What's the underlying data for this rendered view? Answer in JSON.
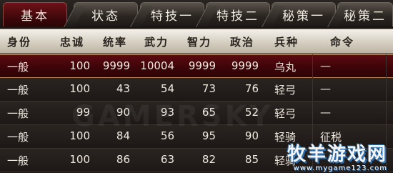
{
  "tabs": [
    {
      "label": "基本",
      "active": true
    },
    {
      "label": "状态",
      "active": false
    },
    {
      "label": "特技一",
      "active": false
    },
    {
      "label": "特技二",
      "active": false
    },
    {
      "label": "秘策一",
      "active": false
    },
    {
      "label": "秘策二",
      "active": false
    }
  ],
  "headers": [
    "身份",
    "忠诚",
    "统率",
    "武力",
    "智力",
    "政治",
    "兵种",
    "命令"
  ],
  "rows": [
    {
      "rank": "一般",
      "loyalty": "100",
      "command": "9999",
      "force": "10004",
      "intel": "9999",
      "politics": "9999",
      "troop": "乌丸",
      "order": "—",
      "selected": true
    },
    {
      "rank": "一般",
      "loyalty": "100",
      "command": "43",
      "force": "54",
      "intel": "73",
      "politics": "76",
      "troop": "轻弓",
      "order": "—",
      "selected": false
    },
    {
      "rank": "一般",
      "loyalty": "99",
      "command": "90",
      "force": "93",
      "intel": "65",
      "politics": "52",
      "troop": "轻弓",
      "order": "—",
      "selected": false
    },
    {
      "rank": "一般",
      "loyalty": "100",
      "command": "84",
      "force": "56",
      "intel": "95",
      "politics": "90",
      "troop": "轻骑",
      "order": "征税",
      "selected": false
    },
    {
      "rank": "一般",
      "loyalty": "100",
      "command": "86",
      "force": "63",
      "intel": "82",
      "politics": "85",
      "troop": "轻骑",
      "order": "",
      "selected": false
    }
  ],
  "watermark": "GAMERSKY",
  "logo": {
    "main": "牧羊游戏网",
    "sub": "www.mygame123.com"
  }
}
